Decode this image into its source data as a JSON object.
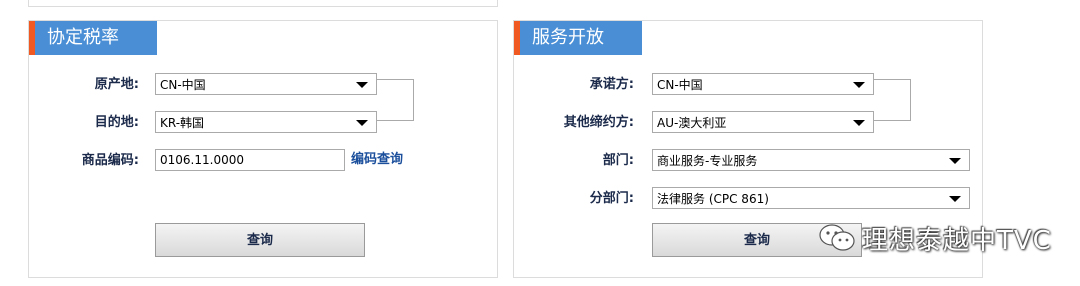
{
  "tariff_panel": {
    "title": "协定税率",
    "origin_label": "原产地:",
    "origin_value": "CN-中国",
    "destination_label": "目的地:",
    "destination_value": "KR-韩国",
    "code_label": "商品编码:",
    "code_value": "0106.11.0000",
    "code_lookup_link": "编码查询",
    "query_button": "查询"
  },
  "service_panel": {
    "title": "服务开放",
    "promisor_label": "承诺方:",
    "promisor_value": "CN-中国",
    "other_party_label": "其他缔约方:",
    "other_party_value": "AU-澳大利亚",
    "department_label": "部门:",
    "department_value": "商业服务-专业服务",
    "subdepartment_label": "分部门:",
    "subdepartment_value": "法律服务 (CPC 861)",
    "query_button": "查询"
  },
  "watermark": {
    "text": "理想泰越中TVC",
    "icon": "wechat-icon"
  }
}
